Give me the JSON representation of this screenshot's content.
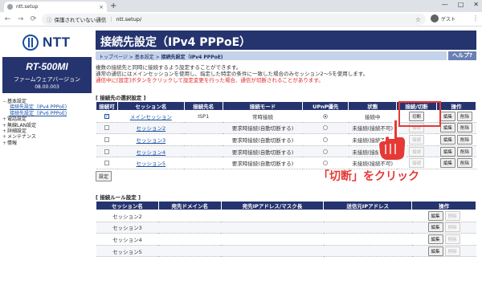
{
  "browser": {
    "tab_title": "ntt.setup",
    "tab_close": "×",
    "new_tab": "+",
    "window_controls": [
      "—",
      "□",
      "✕"
    ],
    "nav": [
      "←",
      "→",
      "⟳"
    ],
    "security_text": "保護されていない通信",
    "url": "ntt.setup/",
    "profile_label": "ゲスト"
  },
  "sidebar": {
    "logo_text": "NTT",
    "model": "RT-500MI",
    "firmware_label": "ファームウェアバージョン",
    "firmware_version": "08.00.003",
    "items": [
      {
        "label": "基本設定",
        "sign": "−",
        "children": [
          "接続先設定（IPv4 PPPoE)",
          "接続先設定（IPv6 PPPoE)"
        ]
      },
      {
        "label": "電話設定",
        "sign": "+"
      },
      {
        "label": "無線LAN設定",
        "sign": "+"
      },
      {
        "label": "詳細設定",
        "sign": "+"
      },
      {
        "label": "メンテナンス",
        "sign": "+"
      },
      {
        "label": "情報",
        "sign": "+"
      }
    ]
  },
  "header": {
    "title": "接続先設定（IPv4 PPPoE）",
    "breadcrumb": [
      "トップページ",
      "基本設定",
      "接続先設定（IPv4 PPPoE)"
    ],
    "breadcrumb_sep": " > ",
    "help": "ヘルプ?"
  },
  "description": {
    "line1": "複数の接続先と同時に接続するよう設定することができます。",
    "line2": "通常の通信にはメインセッションを使用し、指定した特定の条件に一致した場合のみセッション2〜5を使用します。",
    "line3": "通信中に[設定]ボタンをクリックして設定変更を行った場合、通信が切断されることがあります。"
  },
  "sessions": {
    "section_title": "[ 接続先の選択設定 ]",
    "headers": [
      "接続可",
      "セッション名",
      "接続先名",
      "接続モード",
      "UPnP優先",
      "状態",
      "接続/切断",
      "操作"
    ],
    "rows": [
      {
        "enabled": true,
        "name": "メインセッション",
        "dest": "ISP1",
        "mode": "常時接続",
        "upnp": true,
        "status": "接続中",
        "action": "切断",
        "action_enabled": true,
        "edit": "編集",
        "delete": "削除"
      },
      {
        "enabled": false,
        "name": "セッション2",
        "dest": "",
        "mode": "要求時接続(自動切断する)",
        "upnp": false,
        "status": "未接続(接続不可)",
        "action": "接続",
        "action_enabled": false,
        "edit": "編集",
        "delete": "削除"
      },
      {
        "enabled": false,
        "name": "セッション3",
        "dest": "",
        "mode": "要求時接続(自動切断する)",
        "upnp": false,
        "status": "未接続(接続不可)",
        "action": "接続",
        "action_enabled": false,
        "edit": "編集",
        "delete": "削除"
      },
      {
        "enabled": false,
        "name": "セッション4",
        "dest": "",
        "mode": "要求時接続(自動切断する)",
        "upnp": false,
        "status": "未接続(接続不可)",
        "action": "接続",
        "action_enabled": false,
        "edit": "編集",
        "delete": "削除"
      },
      {
        "enabled": false,
        "name": "セッション5",
        "dest": "",
        "mode": "要求時接続(自動切断する)",
        "upnp": false,
        "status": "未接続(接続不可)",
        "action": "接続",
        "action_enabled": false,
        "edit": "編集",
        "delete": "削除"
      }
    ],
    "settei_button": "設定"
  },
  "rules": {
    "section_title": "[ 接続ルール設定 ]",
    "headers": [
      "セッション名",
      "宛先ドメイン名",
      "宛先IPアドレス/マスク長",
      "送信元IPアドレス",
      "操作"
    ],
    "rows": [
      {
        "name": "セッション2",
        "edit": "編集",
        "delete": "削除"
      },
      {
        "name": "セッション3",
        "edit": "編集",
        "delete": "削除"
      },
      {
        "name": "セッション4",
        "edit": "編集",
        "delete": "削除"
      },
      {
        "name": "セッション5",
        "edit": "編集",
        "delete": "削除"
      }
    ]
  },
  "annotation": {
    "callout": "「切断」をクリック",
    "color": "#e53935"
  }
}
